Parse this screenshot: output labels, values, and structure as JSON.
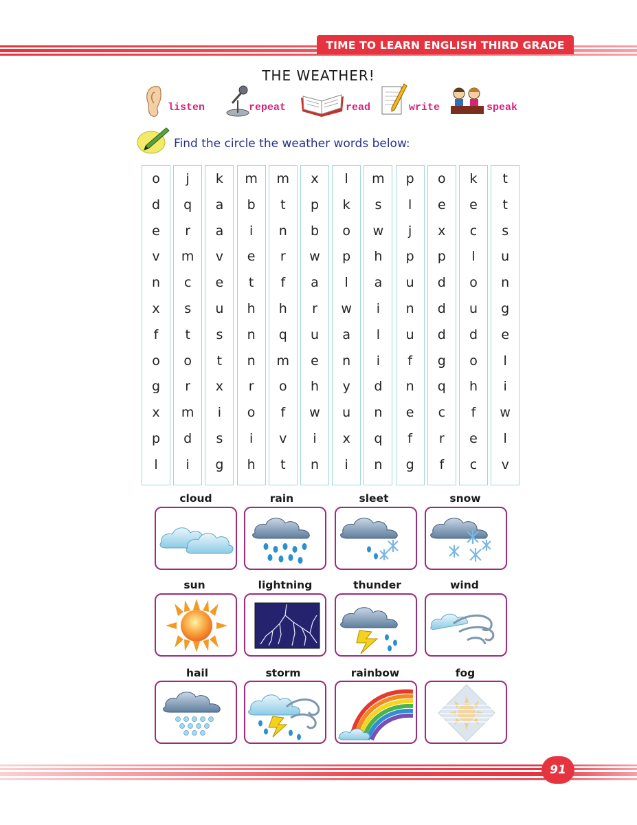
{
  "header": {
    "series_title": "TIME TO LEARN ENGLISH THIRD GRADE",
    "accent_color": "#e5333f"
  },
  "page_title": "THE WEATHER!",
  "skills": [
    {
      "label": "listen",
      "icon": "ear-icon"
    },
    {
      "label": "repeat",
      "icon": "microphone-icon"
    },
    {
      "label": "read",
      "icon": "open-book-icon"
    },
    {
      "label": "write",
      "icon": "paper-pencil-icon"
    },
    {
      "label": "speak",
      "icon": "children-talking-icon"
    }
  ],
  "instruction": "Find the circle the weather words below:",
  "word_search": {
    "rows": [
      [
        "o",
        "j",
        "k",
        "m",
        "m",
        "x",
        "l",
        "m",
        "p",
        "o",
        "k",
        "t"
      ],
      [
        "d",
        "q",
        "a",
        "b",
        "t",
        "p",
        "k",
        "s",
        "l",
        "e",
        "e",
        "t"
      ],
      [
        "e",
        "r",
        "a",
        "i",
        "n",
        "b",
        "o",
        "w",
        "j",
        "x",
        "c",
        "s"
      ],
      [
        "v",
        "m",
        "v",
        "e",
        "r",
        "w",
        "p",
        "h",
        "p",
        "p",
        "l",
        "u"
      ],
      [
        "n",
        "c",
        "e",
        "t",
        "f",
        "a",
        "l",
        "a",
        "u",
        "d",
        "o",
        "n"
      ],
      [
        "x",
        "s",
        "u",
        "h",
        "h",
        "r",
        "w",
        "i",
        "n",
        "d",
        "u",
        "g"
      ],
      [
        "f",
        "t",
        "s",
        "n",
        "q",
        "u",
        "a",
        "l",
        "u",
        "d",
        "d",
        "e"
      ],
      [
        "o",
        "o",
        "t",
        "n",
        "m",
        "e",
        "n",
        "i",
        "f",
        "g",
        "o",
        "l"
      ],
      [
        "g",
        "r",
        "x",
        "r",
        "o",
        "h",
        "y",
        "d",
        "n",
        "q",
        "h",
        "i"
      ],
      [
        "x",
        "m",
        "i",
        "o",
        "f",
        "w",
        "u",
        "n",
        "e",
        "c",
        "f",
        "w"
      ],
      [
        "p",
        "d",
        "s",
        "i",
        "v",
        "i",
        "x",
        "q",
        "f",
        "r",
        "e",
        "l"
      ],
      [
        "l",
        "i",
        "g",
        "h",
        "t",
        "n",
        "i",
        "n",
        "g",
        "f",
        "c",
        "v"
      ]
    ]
  },
  "weather_words": [
    {
      "label": "cloud",
      "icon": "cloud-icon"
    },
    {
      "label": "rain",
      "icon": "rain-icon"
    },
    {
      "label": "sleet",
      "icon": "sleet-icon"
    },
    {
      "label": "snow",
      "icon": "snow-icon"
    },
    {
      "label": "sun",
      "icon": "sun-icon"
    },
    {
      "label": "lightning",
      "icon": "lightning-icon"
    },
    {
      "label": "thunder",
      "icon": "thunder-icon"
    },
    {
      "label": "wind",
      "icon": "wind-icon"
    },
    {
      "label": "hail",
      "icon": "hail-icon"
    },
    {
      "label": "storm",
      "icon": "storm-icon"
    },
    {
      "label": "rainbow",
      "icon": "rainbow-icon"
    },
    {
      "label": "fog",
      "icon": "fog-icon"
    }
  ],
  "page_number": "91"
}
